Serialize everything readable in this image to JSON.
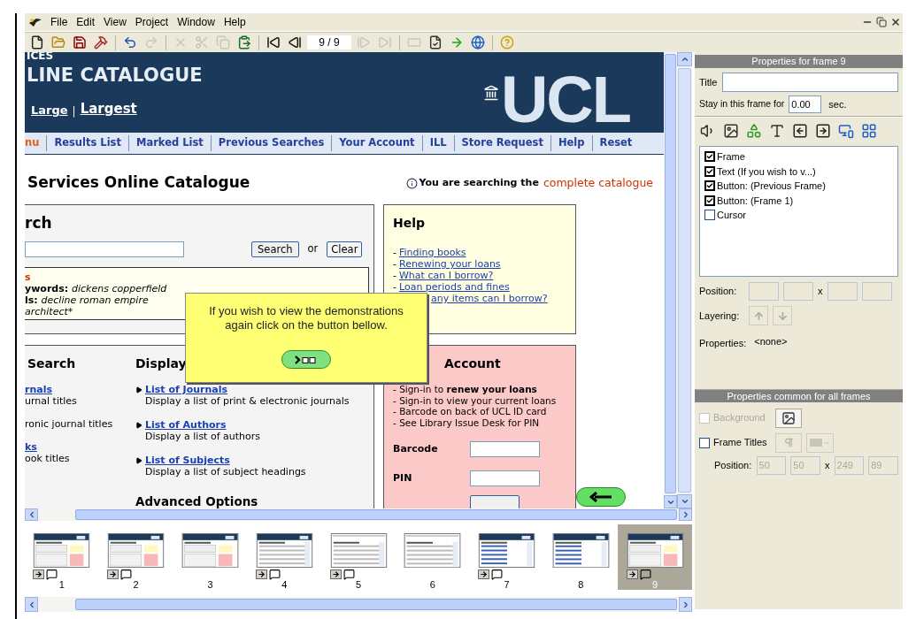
{
  "menu": {
    "items": [
      "File",
      "Edit",
      "View",
      "Project",
      "Window",
      "Help"
    ]
  },
  "toolbar": [
    {
      "kind": "button",
      "disabled": false
    },
    {
      "kind": "button",
      "disabled": false
    },
    {
      "kind": "button",
      "disabled": false
    },
    {
      "kind": "button",
      "disabled": false
    },
    {
      "kind": "separator"
    },
    {
      "kind": "button",
      "disabled": false
    },
    {
      "kind": "button",
      "disabled": true
    },
    {
      "kind": "separator"
    },
    {
      "kind": "button",
      "disabled": true
    },
    {
      "kind": "button",
      "disabled": true
    },
    {
      "kind": "button",
      "disabled": true
    },
    {
      "kind": "button",
      "disabled": false
    },
    {
      "kind": "separator"
    },
    {
      "kind": "button",
      "disabled": false
    },
    {
      "kind": "button",
      "disabled": false
    },
    {
      "kind": "counter",
      "value": "9 / 9"
    },
    {
      "kind": "button",
      "disabled": true
    },
    {
      "kind": "button",
      "disabled": true
    },
    {
      "kind": "separator"
    },
    {
      "kind": "button",
      "disabled": true
    },
    {
      "kind": "button",
      "disabled": false
    },
    {
      "kind": "button",
      "disabled": false
    },
    {
      "kind": "button",
      "disabled": false
    },
    {
      "kind": "separator"
    },
    {
      "kind": "button",
      "disabled": false
    }
  ],
  "page": {
    "header": {
      "kicker": "ICES",
      "title": "LINE CATALOGUE",
      "size_links": [
        "Large",
        "Largest"
      ],
      "size_separator": "|",
      "logo": "UCL"
    },
    "nav": [
      {
        "label": "nu",
        "selected": true
      },
      {
        "label": "Results List",
        "selected": false
      },
      {
        "label": "Marked List",
        "selected": false
      },
      {
        "label": "Previous Searches",
        "selected": false
      },
      {
        "label": "Your Account",
        "selected": false
      },
      {
        "label": "ILL",
        "selected": false
      },
      {
        "label": "Store Request",
        "selected": false
      },
      {
        "label": "Help",
        "selected": false
      },
      {
        "label": "Reset",
        "selected": false
      }
    ],
    "heading": "Services Online Catalogue",
    "notice": {
      "text": "You are searching the",
      "highlight": "complete catalogue"
    },
    "search_panel": {
      "title": "rch",
      "search_button": "Search",
      "or": "or",
      "clear_button": "Clear",
      "examples_title": "s",
      "examples": [
        {
          "label": "ywords:",
          "value": "dickens copperfield"
        },
        {
          "label": "ls:",
          "value": "decline roman empire"
        },
        {
          "value": "architect*"
        }
      ]
    },
    "help": {
      "title": "Help",
      "links": [
        {
          "prefix": "-",
          "label": "Finding books"
        },
        {
          "prefix": "-",
          "label": "Renewing your loans"
        },
        {
          "prefix": "-",
          "label": "What can I borrow?"
        },
        {
          "prefix": "-",
          "label": "Loan periods and fines"
        },
        {
          "label": "any items can I borrow?"
        }
      ]
    },
    "browse": {
      "column_1": {
        "title": "Search",
        "items": [
          {
            "link": "rnals",
            "description": "urnal titles"
          },
          {
            "description": "ronic journal titles"
          },
          {
            "link": "ks",
            "description": "ook titles"
          }
        ]
      },
      "column_2": {
        "title": "Display",
        "items": [
          {
            "link": "List of Journals",
            "description": "Display a list of print & electronic journals"
          },
          {
            "link": "List of Authors",
            "description": "Display a list of authors"
          },
          {
            "link": "List of Subjects",
            "description": "Display a list of subject headings"
          }
        ],
        "footer": "Advanced Options"
      }
    },
    "account": {
      "title": "Account",
      "lines": [
        "- Sign-in to **renew your loans**",
        "- Sign-in to view your current loans",
        "- Barcode on back of UCL ID card",
        "- See Library Issue Desk for PIN"
      ],
      "fields": [
        {
          "label": "Barcode"
        },
        {
          "label": "PIN"
        }
      ]
    }
  },
  "popup": {
    "text": "If you wish to view the demonstrations again click on the button bellow."
  },
  "right_panel": {
    "frame_header": "Properties for frame 9",
    "title_label": "Title",
    "stay_label": "Stay in this frame for",
    "stay_value": "0.00",
    "stay_unit": "sec.",
    "objects": [
      {
        "label": "Frame",
        "checked": true
      },
      {
        "label": "Text (If you wish to v...)",
        "checked": true
      },
      {
        "label": "Button: (Previous Frame)",
        "checked": true
      },
      {
        "label": "Button: (Frame 1)",
        "checked": true
      },
      {
        "label": "Cursor",
        "checked": false
      }
    ],
    "position_label": "Position:",
    "position_separator": "x",
    "layering_label": "Layering:",
    "properties_label": "Properties:",
    "properties_value": "<none>",
    "common_header": "Properties common for all frames",
    "background": {
      "label": "Background",
      "checked": false,
      "disabled": true
    },
    "frame_titles": {
      "label": "Frame Titles",
      "checked": false,
      "disabled": false
    },
    "common_position": {
      "label": "Position:",
      "separator": "x",
      "values": [
        "50",
        "50",
        "249",
        "89"
      ]
    }
  },
  "filmstrip": [
    {
      "label": "1",
      "selected": false,
      "actions": true,
      "kind": "catalogue"
    },
    {
      "label": "2",
      "selected": false,
      "actions": true,
      "kind": "catalogue"
    },
    {
      "label": "3",
      "selected": false,
      "actions": false,
      "kind": "catalogue"
    },
    {
      "label": "4",
      "selected": false,
      "actions": true,
      "kind": "search"
    },
    {
      "label": "5",
      "selected": false,
      "actions": true,
      "kind": "form"
    },
    {
      "label": "6",
      "selected": false,
      "actions": false,
      "kind": "form"
    },
    {
      "label": "7",
      "selected": false,
      "actions": true,
      "kind": "list"
    },
    {
      "label": "8",
      "selected": false,
      "actions": false,
      "kind": "list"
    },
    {
      "label": "9",
      "selected": true,
      "actions": true,
      "kind": "catalogue"
    }
  ]
}
